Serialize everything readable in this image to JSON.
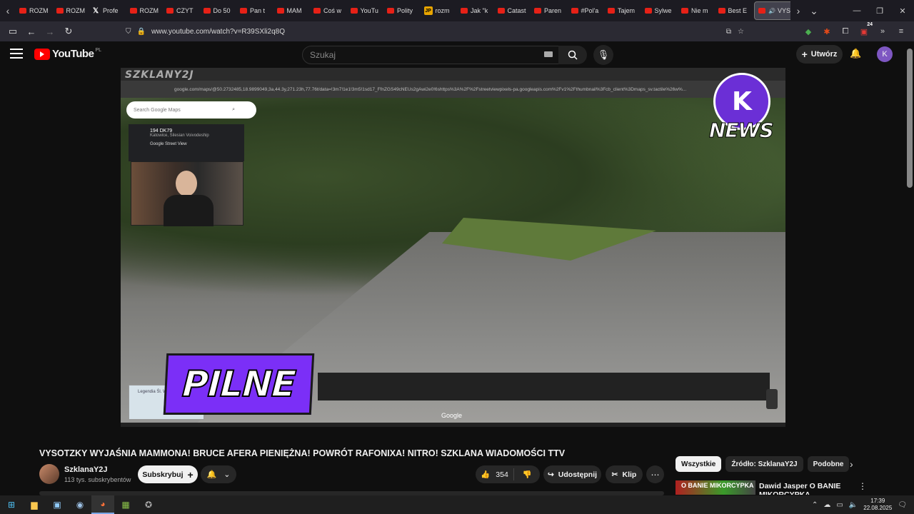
{
  "browser": {
    "tabs": [
      {
        "label": "ROZM",
        "icon": "youtube-icon"
      },
      {
        "label": "ROZM",
        "icon": "youtube-icon"
      },
      {
        "label": "Profe",
        "icon": "x-icon"
      },
      {
        "label": "ROZM",
        "icon": "youtube-icon"
      },
      {
        "label": "CZYT",
        "icon": "youtube-icon"
      },
      {
        "label": "Do 50",
        "icon": "youtube-icon"
      },
      {
        "label": "Pan t",
        "icon": "youtube-icon"
      },
      {
        "label": "MAM",
        "icon": "youtube-icon"
      },
      {
        "label": "Coś w",
        "icon": "youtube-icon"
      },
      {
        "label": "YouTu",
        "icon": "youtube-icon"
      },
      {
        "label": "Polity",
        "icon": "youtube-icon"
      },
      {
        "label": "rozm",
        "icon": "jp-icon"
      },
      {
        "label": "Jak \"k",
        "icon": "youtube-icon"
      },
      {
        "label": "Catast",
        "icon": "youtube-icon"
      },
      {
        "label": "Paren",
        "icon": "youtube-icon"
      },
      {
        "label": "#Pol'a",
        "icon": "youtube-icon"
      },
      {
        "label": "Tajem",
        "icon": "youtube-icon"
      },
      {
        "label": "Sylwe",
        "icon": "youtube-icon"
      },
      {
        "label": "Nie m",
        "icon": "youtube-icon"
      },
      {
        "label": "Best E",
        "icon": "youtube-icon"
      }
    ],
    "active_tab": {
      "label": "VYS",
      "icon": "youtube-icon"
    },
    "url": "www.youtube.com/watch?v=R39SXli2q8Q",
    "extension_badge": "24"
  },
  "youtube": {
    "logo_text": "YouTube",
    "region": "PL",
    "search_placeholder": "Szukaj",
    "create_label": "Utwórz",
    "avatar_letter": "K"
  },
  "video": {
    "overlay_channel": "SZKLANY2J",
    "maps_url": "google.com/maps/@50.2732485,18.9899049,3a,44.3y,271.23h,77.76t/data=!3m7!1e1!3m5!1sd17_FfnZGS49cNEUs2gAwi2e0!6shttps%3A%2F%2Fstreetviewpixels-pa.googleapis.com%2Fv1%2Fthumbnail%3Fcb_client%3Dmaps_sv.tactile%26w%...",
    "maps_search_placeholder": "Search Google Maps",
    "place_title": "194 DK79",
    "place_subtitle": "Katowice, Silesian Voivodeship",
    "street_view_label": "Google Street View",
    "news_logo_letters": "K",
    "news_logo_text": "NEWS",
    "banner": "PILNE",
    "minimap_label": "Legendia Śl. Wesołe Miasto",
    "google_watermark": "Google"
  },
  "info": {
    "title": "VYSOTZKY WYJAŚNIA MAMMONA! BRUCE AFERA PIENIĘŻNA! POWRÓT RAFONIXA! NITRO! SZKLANA WIADOMOŚCI TTV",
    "channel": "SzklanaY2J",
    "subscribers": "113 tys. subskrybentów",
    "subscribe_label": "Subskrybuj",
    "likes": "354",
    "share_label": "Udostępnij",
    "clip_label": "Klip"
  },
  "sidebar": {
    "chips": [
      "Wszystkie",
      "Źródło: SzklanaY2J",
      "Podobne"
    ],
    "recommendation": {
      "thumb_text": "O BANIE MIKORCYPKA",
      "title": "Dawid Jasper O BANIE MIKORCYPKA"
    }
  },
  "taskbar": {
    "time": "17:39",
    "date": "22.08.2025"
  },
  "colors": {
    "yt_red": "#ff0000",
    "pilne_purple": "#7b2ff7",
    "news_purple": "#6b2fd6"
  }
}
